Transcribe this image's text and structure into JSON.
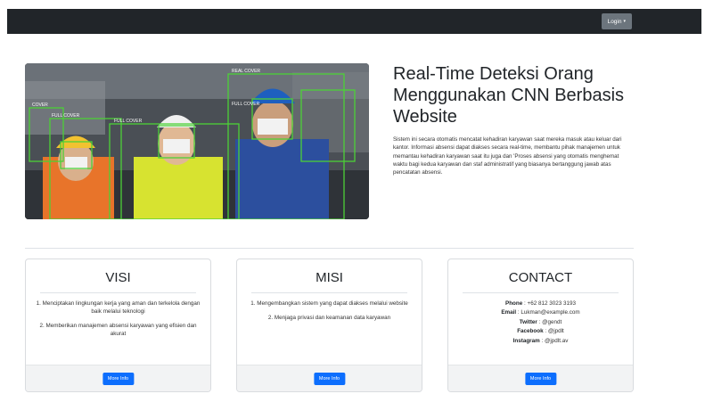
{
  "navbar": {
    "login_label": "Login"
  },
  "hero": {
    "image_alt": "Workers wearing hard hats and masks with detection boxes",
    "detection_labels": [
      "REAL COVER",
      "FULL COVER",
      "FULL COVER",
      "FULL COVER",
      "COVER"
    ],
    "title": "Real-Time Deteksi Orang Menggunakan CNN Berbasis Website",
    "description": "Sistem ini secara otomatis mencatat kehadiran karyawan saat mereka masuk atau keluar dari kantor. Informasi absensi dapat diakses secara real-time, membantu pihak manajemen untuk memantau kehadiran karyawan saat itu juga dan 'Proses absensi yang otomatis menghemat waktu bagi kedua karyawan dan staf administratif yang biasanya bertanggung jawab atas pencatatan absensi."
  },
  "cards": {
    "visi": {
      "title": "VISI",
      "items": [
        "1. Menciptakan lingkungan kerja yang aman dan terkelola dengan baik melalui teknologi",
        "2. Memberikan manajemen absensi karyawan yang efisien dan akurat"
      ],
      "button": "More Info"
    },
    "misi": {
      "title": "MISI",
      "items": [
        "1. Mengembangkan sistem yang dapat diakses melalui website",
        "2. Menjaga privasi dan keamanan data karyawan"
      ],
      "button": "More Info"
    },
    "contact": {
      "title": "CONTACT",
      "rows": [
        {
          "label": "Phone",
          "value": "+62 812 3023 3193"
        },
        {
          "label": "Email",
          "value": "Lukman@example.com"
        },
        {
          "label": "Twitter",
          "value": "@gendt"
        },
        {
          "label": "Facebook",
          "value": "@jpdlt"
        },
        {
          "label": "Instagram",
          "value": "@jpdlt.av"
        }
      ],
      "button": "More Info"
    }
  },
  "colors": {
    "navbar": "#212529",
    "primary": "#0d6efd",
    "secondary": "#6c757d",
    "detection_box": "#4cd137"
  },
  "icons": {
    "login_caret": "caret-down-icon"
  }
}
